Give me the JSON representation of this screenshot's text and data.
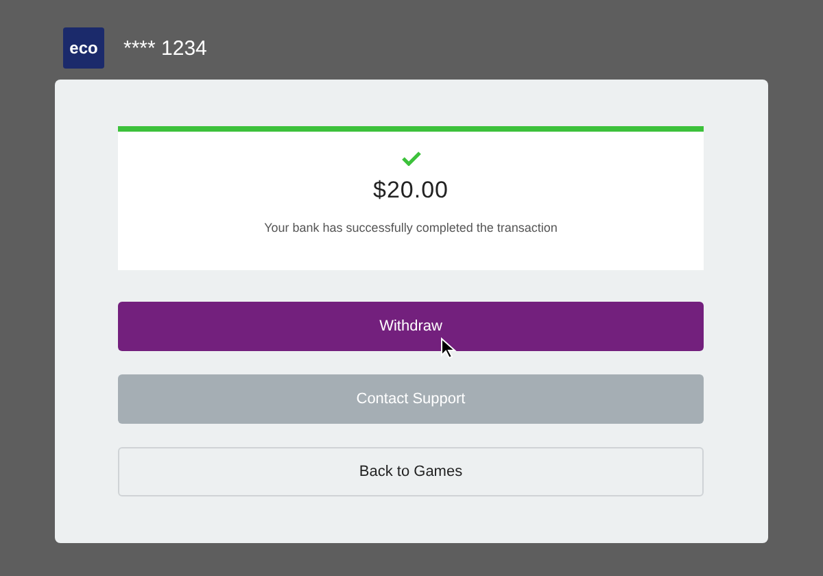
{
  "account": {
    "logo": "eco",
    "number": "**** 1234"
  },
  "result": {
    "succeeded": true,
    "amount": "$20.00",
    "message": "Your bank has successfully completed the transaction"
  },
  "buttons": [
    {
      "label": "Withdraw",
      "kind": "primary",
      "hovered": true
    },
    {
      "label": "Contact Support",
      "kind": "secondary",
      "hovered": false
    },
    {
      "label": "Back to Games",
      "kind": "outline",
      "hovered": false
    }
  ]
}
